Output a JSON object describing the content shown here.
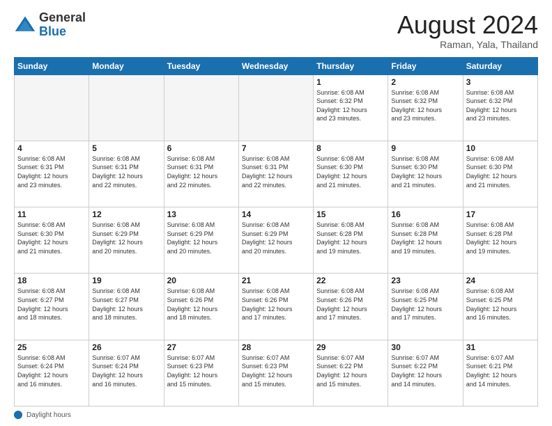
{
  "logo": {
    "general": "General",
    "blue": "Blue"
  },
  "header": {
    "month": "August 2024",
    "location": "Raman, Yala, Thailand"
  },
  "weekdays": [
    "Sunday",
    "Monday",
    "Tuesday",
    "Wednesday",
    "Thursday",
    "Friday",
    "Saturday"
  ],
  "footer": {
    "label": "Daylight hours"
  },
  "weeks": [
    [
      {
        "num": "",
        "info": "",
        "empty": true
      },
      {
        "num": "",
        "info": "",
        "empty": true
      },
      {
        "num": "",
        "info": "",
        "empty": true
      },
      {
        "num": "",
        "info": "",
        "empty": true
      },
      {
        "num": "1",
        "info": "Sunrise: 6:08 AM\nSunset: 6:32 PM\nDaylight: 12 hours\nand 23 minutes."
      },
      {
        "num": "2",
        "info": "Sunrise: 6:08 AM\nSunset: 6:32 PM\nDaylight: 12 hours\nand 23 minutes."
      },
      {
        "num": "3",
        "info": "Sunrise: 6:08 AM\nSunset: 6:32 PM\nDaylight: 12 hours\nand 23 minutes."
      }
    ],
    [
      {
        "num": "4",
        "info": "Sunrise: 6:08 AM\nSunset: 6:31 PM\nDaylight: 12 hours\nand 23 minutes."
      },
      {
        "num": "5",
        "info": "Sunrise: 6:08 AM\nSunset: 6:31 PM\nDaylight: 12 hours\nand 22 minutes."
      },
      {
        "num": "6",
        "info": "Sunrise: 6:08 AM\nSunset: 6:31 PM\nDaylight: 12 hours\nand 22 minutes."
      },
      {
        "num": "7",
        "info": "Sunrise: 6:08 AM\nSunset: 6:31 PM\nDaylight: 12 hours\nand 22 minutes."
      },
      {
        "num": "8",
        "info": "Sunrise: 6:08 AM\nSunset: 6:30 PM\nDaylight: 12 hours\nand 21 minutes."
      },
      {
        "num": "9",
        "info": "Sunrise: 6:08 AM\nSunset: 6:30 PM\nDaylight: 12 hours\nand 21 minutes."
      },
      {
        "num": "10",
        "info": "Sunrise: 6:08 AM\nSunset: 6:30 PM\nDaylight: 12 hours\nand 21 minutes."
      }
    ],
    [
      {
        "num": "11",
        "info": "Sunrise: 6:08 AM\nSunset: 6:30 PM\nDaylight: 12 hours\nand 21 minutes."
      },
      {
        "num": "12",
        "info": "Sunrise: 6:08 AM\nSunset: 6:29 PM\nDaylight: 12 hours\nand 20 minutes."
      },
      {
        "num": "13",
        "info": "Sunrise: 6:08 AM\nSunset: 6:29 PM\nDaylight: 12 hours\nand 20 minutes."
      },
      {
        "num": "14",
        "info": "Sunrise: 6:08 AM\nSunset: 6:29 PM\nDaylight: 12 hours\nand 20 minutes."
      },
      {
        "num": "15",
        "info": "Sunrise: 6:08 AM\nSunset: 6:28 PM\nDaylight: 12 hours\nand 19 minutes."
      },
      {
        "num": "16",
        "info": "Sunrise: 6:08 AM\nSunset: 6:28 PM\nDaylight: 12 hours\nand 19 minutes."
      },
      {
        "num": "17",
        "info": "Sunrise: 6:08 AM\nSunset: 6:28 PM\nDaylight: 12 hours\nand 19 minutes."
      }
    ],
    [
      {
        "num": "18",
        "info": "Sunrise: 6:08 AM\nSunset: 6:27 PM\nDaylight: 12 hours\nand 18 minutes."
      },
      {
        "num": "19",
        "info": "Sunrise: 6:08 AM\nSunset: 6:27 PM\nDaylight: 12 hours\nand 18 minutes."
      },
      {
        "num": "20",
        "info": "Sunrise: 6:08 AM\nSunset: 6:26 PM\nDaylight: 12 hours\nand 18 minutes."
      },
      {
        "num": "21",
        "info": "Sunrise: 6:08 AM\nSunset: 6:26 PM\nDaylight: 12 hours\nand 17 minutes."
      },
      {
        "num": "22",
        "info": "Sunrise: 6:08 AM\nSunset: 6:26 PM\nDaylight: 12 hours\nand 17 minutes."
      },
      {
        "num": "23",
        "info": "Sunrise: 6:08 AM\nSunset: 6:25 PM\nDaylight: 12 hours\nand 17 minutes."
      },
      {
        "num": "24",
        "info": "Sunrise: 6:08 AM\nSunset: 6:25 PM\nDaylight: 12 hours\nand 16 minutes."
      }
    ],
    [
      {
        "num": "25",
        "info": "Sunrise: 6:08 AM\nSunset: 6:24 PM\nDaylight: 12 hours\nand 16 minutes."
      },
      {
        "num": "26",
        "info": "Sunrise: 6:07 AM\nSunset: 6:24 PM\nDaylight: 12 hours\nand 16 minutes."
      },
      {
        "num": "27",
        "info": "Sunrise: 6:07 AM\nSunset: 6:23 PM\nDaylight: 12 hours\nand 15 minutes."
      },
      {
        "num": "28",
        "info": "Sunrise: 6:07 AM\nSunset: 6:23 PM\nDaylight: 12 hours\nand 15 minutes."
      },
      {
        "num": "29",
        "info": "Sunrise: 6:07 AM\nSunset: 6:22 PM\nDaylight: 12 hours\nand 15 minutes."
      },
      {
        "num": "30",
        "info": "Sunrise: 6:07 AM\nSunset: 6:22 PM\nDaylight: 12 hours\nand 14 minutes."
      },
      {
        "num": "31",
        "info": "Sunrise: 6:07 AM\nSunset: 6:21 PM\nDaylight: 12 hours\nand 14 minutes."
      }
    ]
  ]
}
